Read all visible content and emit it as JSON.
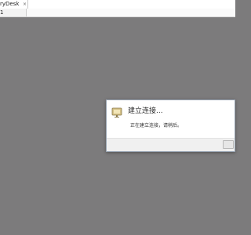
{
  "window": {
    "title_fragment": "ryDesk",
    "close_glyph": "×"
  },
  "tabs": [
    {
      "label": "1"
    }
  ],
  "dialog": {
    "title": "建立连接...",
    "message": "正在建立连接，请稍后。",
    "icon": "monitor-icon"
  },
  "colors": {
    "remote_background": "#7c7b7c",
    "dialog_background": "#ffffff",
    "dialog_footer": "#f0f0f0"
  }
}
